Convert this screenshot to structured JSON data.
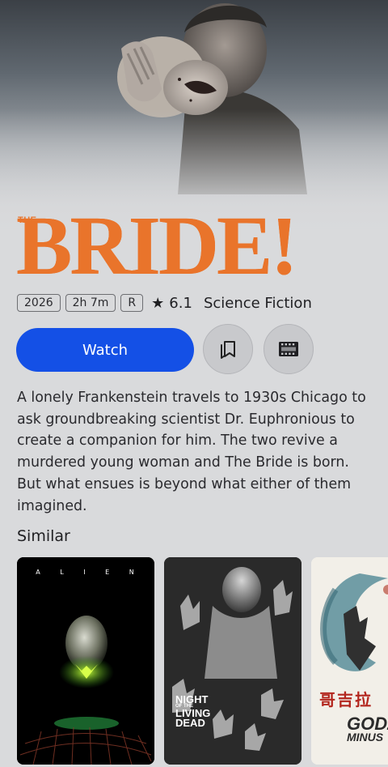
{
  "movie": {
    "logo_prefix": "THE",
    "logo_word": "BRIDE!",
    "year": "2026",
    "runtime": "2h 7m",
    "certificate": "R",
    "rating": "6.1",
    "genre": "Science Fiction",
    "description": "A lonely Frankenstein travels to 1930s Chicago to ask groundbreaking scientist Dr. Euphronious to create a companion for him. The two revive a murdered young woman and The Bride is born. But what ensues is beyond what either of them imagined."
  },
  "actions": {
    "watch_label": "Watch",
    "save_icon": "bookmark-stack-icon",
    "trailer_icon": "film-strip-icon"
  },
  "similar": {
    "title": "Similar",
    "items": [
      {
        "title_text": "A L I E N"
      },
      {
        "title_line1": "NIGHT",
        "title_line2": "OF THE",
        "title_line3": "LIVING",
        "title_line4": "DEAD"
      },
      {
        "kanji": "哥吉拉",
        "title_line1": "GODZ",
        "title_line2": "MINUS"
      }
    ]
  },
  "colors": {
    "accent_blue": "#1450e6",
    "logo_orange": "#e9742b",
    "background": "#d9dadc"
  }
}
